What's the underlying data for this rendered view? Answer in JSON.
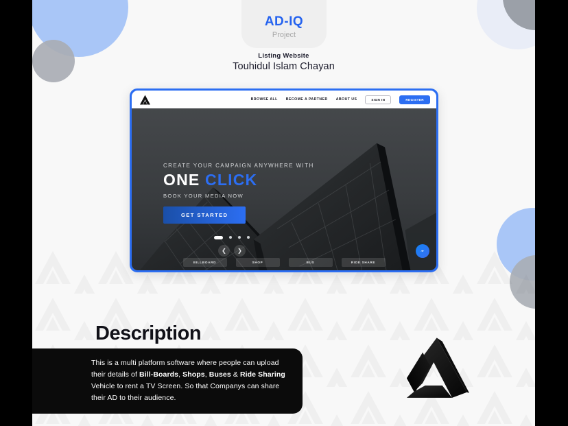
{
  "page": {
    "background_color": "#f8f8f8",
    "frame_color": "#000000",
    "accent_color": "#2c6ef2"
  },
  "header": {
    "project_badge": {
      "title": "AD-IQ",
      "subtitle": "Project",
      "title_color": "#2563ef",
      "card_color": "#efefef"
    },
    "category_label": "Listing Website",
    "author_name": "Touhidul Islam Chayan"
  },
  "mockup": {
    "frame_color": "#2c6ef2",
    "nav": {
      "logo_icon": "adiq-a-logo-icon",
      "links": [
        {
          "label": "BROWSE ALL"
        },
        {
          "label": "BECOME A PARTNER"
        },
        {
          "label": "ABOUT US"
        }
      ],
      "sign_in_label": "SIGN IN",
      "register_label": "REGISTER"
    },
    "hero": {
      "eyebrow": "CREATE YOUR CAMPAIGN ANYWHERE WITH",
      "headline_plain": "ONE",
      "headline_accent": "CLICK",
      "subline": "BOOK YOUR MEDIA NOW",
      "cta_label": "GET STARTED",
      "background_color": "#3a3d40",
      "carousel": {
        "dot_count": 4,
        "active_index": 0,
        "prev_icon": "chevron-left-icon",
        "next_icon": "chevron-right-icon"
      }
    },
    "category_tabs": [
      {
        "label": "BILLBOARD"
      },
      {
        "label": "SHOP"
      },
      {
        "label": "BUS"
      },
      {
        "label": "RIDE SHARE"
      }
    ],
    "messenger_icon": "facebook-messenger-icon"
  },
  "description": {
    "title": "Description",
    "body_intro": "This is a multi platform software where people can upload their details of ",
    "bold_1": "Bill-Boards",
    "sep_1": ", ",
    "bold_2": "Shops",
    "sep_2": ", ",
    "bold_3": "Buses",
    "sep_3": " & ",
    "bold_4": "Ride Sharing",
    "body_outro": " Vehicle to rent a TV Screen. So that Companys can share their AD to their audience.",
    "box_color": "#0b0b0b"
  },
  "branding": {
    "watermark_icon": "adiq-a-logo-watermark-icon",
    "big_logo_icon": "adiq-a-logo-icon"
  },
  "decorations": {
    "circles": [
      {
        "name": "circle-blue-top-left",
        "color": "#a9c6f7"
      },
      {
        "name": "circle-gray-top-left",
        "color": "#a9adb4"
      },
      {
        "name": "circle-pale-top-right",
        "color": "#e9edf7"
      },
      {
        "name": "circle-gray-top-right",
        "color": "#9ba0a8"
      },
      {
        "name": "circle-blue-right",
        "color": "#a9c6f7"
      },
      {
        "name": "circle-gray-right",
        "color": "#a9adb4"
      }
    ]
  }
}
